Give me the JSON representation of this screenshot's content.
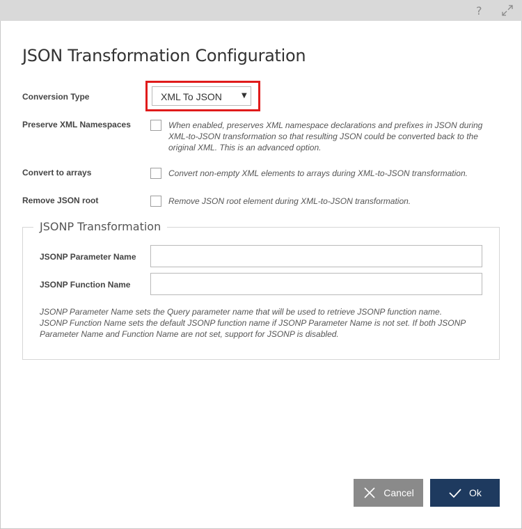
{
  "titlebar": {
    "help_icon": "?",
    "icons": [
      "question-icon",
      "expand-icon"
    ]
  },
  "dialog": {
    "title": "JSON Transformation Configuration"
  },
  "conversion": {
    "label": "Conversion Type",
    "value": "XML To JSON",
    "caret": "▼",
    "highlight_color": "#e01b1b"
  },
  "options": [
    {
      "label": "Preserve XML Namespaces",
      "checked": false,
      "desc_lines": [
        "When enabled, preserves XML namespace declarations and prefixes in JSON during",
        "XML-to-JSON transformation so that resulting JSON could be converted back to the",
        "original XML. This is an advanced option."
      ]
    },
    {
      "label": "Convert to arrays",
      "checked": false,
      "desc_lines": [
        "Convert non-empty XML elements to arrays during XML-to-JSON transformation."
      ]
    },
    {
      "label": "Remove JSON root",
      "checked": false,
      "desc_lines": [
        "Remove JSON root element during XML-to-JSON transformation."
      ]
    }
  ],
  "jsonp": {
    "legend": "JSONP Transformation",
    "param_label": "JSONP Parameter Name",
    "param_value": "",
    "func_label": "JSONP Function Name",
    "func_value": "",
    "desc_lines": [
      "JSONP Parameter Name sets the Query parameter name that will be used to retrieve JSONP function name.",
      "JSONP Function Name sets the default JSONP function name if JSONP Parameter Name is not set. If both JSONP",
      "Parameter Name and Function Name are not set, support for JSONP is disabled."
    ]
  },
  "buttons": {
    "cancel_label": "Cancel",
    "ok_label": "Ok",
    "cancel_color": "#8a8a8a",
    "ok_color": "#1e3a5f"
  }
}
